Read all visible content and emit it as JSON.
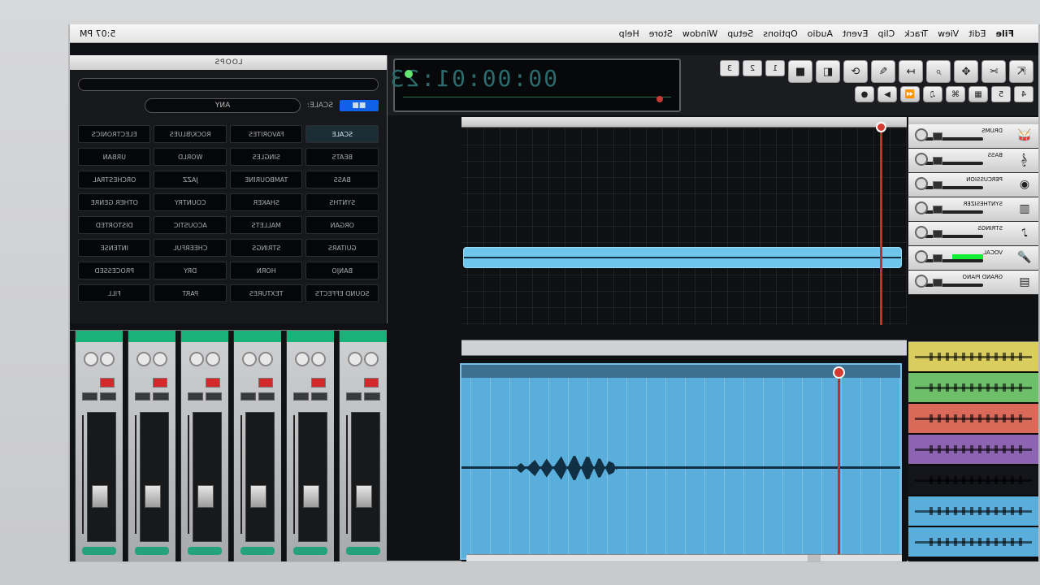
{
  "menu": {
    "apple": "",
    "app": "File",
    "items": [
      "Edit",
      "View",
      "Track",
      "Clip",
      "Event",
      "Audio",
      "Options",
      "Setup",
      "Window",
      "Store",
      "Help"
    ],
    "clock": "5:07 PM"
  },
  "transport": {
    "time": "00:00:01:23"
  },
  "loops": {
    "title": "LOOPS",
    "scale_label": "SCALE:",
    "scale_value": "ANY",
    "tags": [
      [
        "SCALE",
        "FAVORITES",
        "ROCK/BLUES",
        "ELECTRONICS"
      ],
      [
        "BEATS",
        "SINGLES",
        "WORLD",
        "URBAN"
      ],
      [
        "BASS",
        "TAMBOURINE",
        "JAZZ",
        "ORCHESTRAL"
      ],
      [
        "SYNTHS",
        "SHAKER",
        "COUNTRY",
        "OTHER GENRE"
      ],
      [
        "ORGAN",
        "MALLETS",
        "ACOUSTIC",
        "DISTORTED"
      ],
      [
        "GUITARS",
        "STRINGS",
        "CHEERFUL",
        "INTENSE"
      ],
      [
        "BANJO",
        "HORN",
        "DRY",
        "PROCESSED"
      ],
      [
        "SOUND EFFECTS",
        "TEXTURES",
        "PART",
        "FILL"
      ]
    ]
  },
  "tracks": [
    {
      "label": "DRUMS",
      "icon": "drum-icon"
    },
    {
      "label": "BASS",
      "icon": "guitar-icon"
    },
    {
      "label": "PERCUSSION",
      "icon": "snare-icon"
    },
    {
      "label": "SYNTHESIZER",
      "icon": "keyboard-icon"
    },
    {
      "label": "STRINGS",
      "icon": "violin-icon"
    },
    {
      "label": "VOCAL",
      "icon": "microphone-icon",
      "active": true
    },
    {
      "label": "GRAND PIANO",
      "icon": "piano-icon"
    }
  ],
  "mixer": {
    "strips": [
      "",
      "",
      "",
      "",
      "",
      ""
    ]
  },
  "accent": {
    "blue": "#5aaedc",
    "red": "#c43029",
    "green": "#10ee34"
  }
}
